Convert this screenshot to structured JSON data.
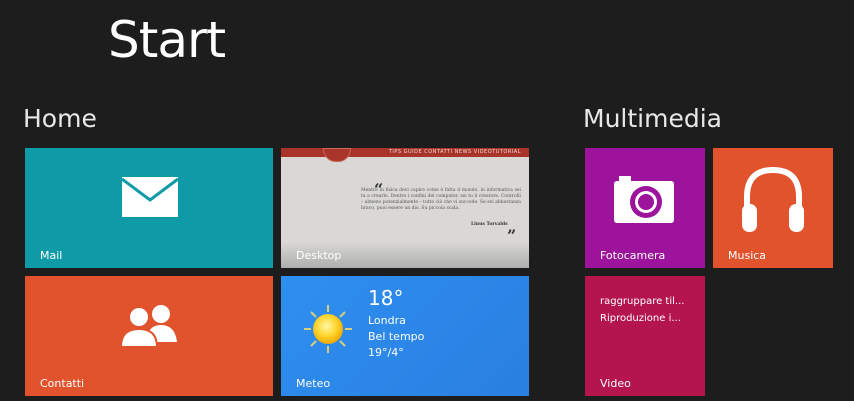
{
  "screen": {
    "title": "Start"
  },
  "groups": {
    "home": {
      "title": "Home"
    },
    "multimedia": {
      "title": "Multimedia"
    }
  },
  "tiles": {
    "mail": {
      "label": "Mail",
      "icon": "envelope-icon",
      "color": "#0e9aa7"
    },
    "desktop": {
      "label": "Desktop",
      "color": "#d9d8d4",
      "nav": "TIPS  GUIDE  CONTATTI  NEWS  VIDEOTUTORIAL",
      "quote": "Mentre in fisica devi capire come è fatta il mondo, in informatica sei tu a crearlo. Dentro i confini del computer, sei tu il creatore. Controlli – almeno potenzialmente – tutto ciò che vi succede. Se sei abbastanza bravo, puoi essere un dio. Su piccola scala.",
      "author": "Linus Torvalds"
    },
    "contatti": {
      "label": "Contatti",
      "icon": "people-icon",
      "color": "#e0532d"
    },
    "meteo": {
      "label": "Meteo",
      "icon": "sun-icon",
      "temperature": "18°",
      "city": "Londra",
      "condition": "Bel tempo",
      "range": "19°/4°",
      "color": "#2d88ea"
    },
    "fotocamera": {
      "label": "Fotocamera",
      "icon": "camera-icon",
      "color": "#9d139b"
    },
    "musica": {
      "label": "Musica",
      "icon": "headphones-icon",
      "color": "#e0532d"
    },
    "video": {
      "label": "Video",
      "line1": "raggruppare til...",
      "line2": "Riproduzione i...",
      "color": "#b4154d"
    }
  }
}
